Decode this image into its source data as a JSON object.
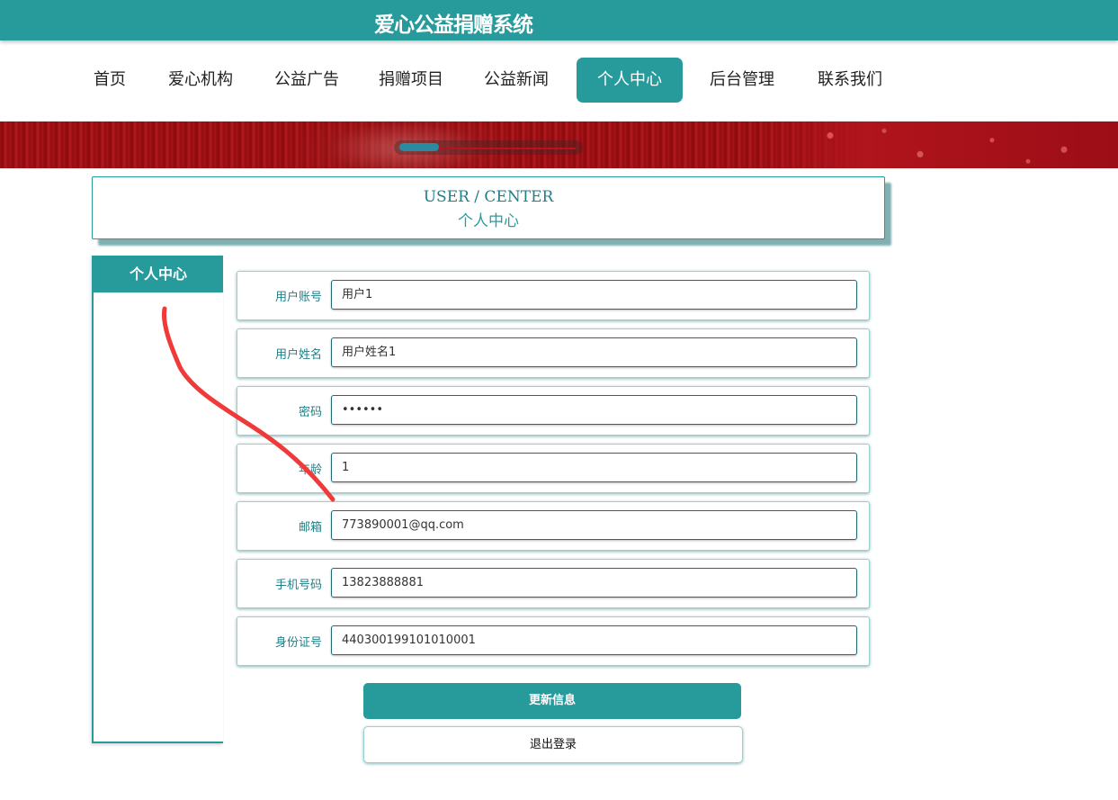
{
  "site": {
    "title": "爱心公益捐赠系统"
  },
  "nav": {
    "items": [
      {
        "label": "首页",
        "active": false
      },
      {
        "label": "爱心机构",
        "active": false
      },
      {
        "label": "公益广告",
        "active": false
      },
      {
        "label": "捐赠项目",
        "active": false
      },
      {
        "label": "公益新闻",
        "active": false
      },
      {
        "label": "个人中心",
        "active": true
      },
      {
        "label": "后台管理",
        "active": false
      },
      {
        "label": "联系我们",
        "active": false
      }
    ]
  },
  "section": {
    "title_en": "USER / CENTER",
    "title_zh": "个人中心"
  },
  "sidebar": {
    "title": "个人中心"
  },
  "form": {
    "fields": [
      {
        "label": "用户账号",
        "value": "用户1"
      },
      {
        "label": "用户姓名",
        "value": "用户姓名1"
      },
      {
        "label": "密码",
        "value": "••••••"
      },
      {
        "label": "年龄",
        "value": "1"
      },
      {
        "label": "邮箱",
        "value": "773890001@qq.com"
      },
      {
        "label": "手机号码",
        "value": "13823888881"
      },
      {
        "label": "身份证号",
        "value": "440300199101010001"
      }
    ],
    "update_label": "更新信息",
    "logout_label": "退出登录"
  },
  "colors": {
    "primary": "#279a9c",
    "annotation": "#f03a3a",
    "banner": "#9e0f13"
  }
}
